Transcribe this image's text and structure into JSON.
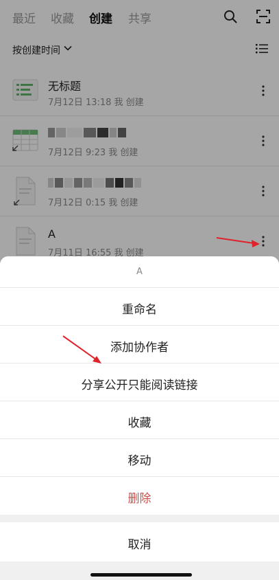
{
  "tabs": [
    {
      "label": "最近",
      "active": false
    },
    {
      "label": "收藏",
      "active": false
    },
    {
      "label": "创建",
      "active": true
    },
    {
      "label": "共享",
      "active": false
    }
  ],
  "sort": {
    "label": "按创建时间"
  },
  "documents": [
    {
      "title": "无标题",
      "meta": "7月12日 13:18 我 创建"
    },
    {
      "title": "",
      "meta": "7月12日 9:23 我 创建"
    },
    {
      "title": "",
      "meta": "7月12日 0:15 我 创建"
    },
    {
      "title": "A",
      "meta": "7月11日 16:55 我 创建"
    }
  ],
  "action_sheet": {
    "title": "A",
    "items": [
      "重命名",
      "添加协作者",
      "分享公开只能阅读链接",
      "收藏",
      "移动",
      "删除"
    ],
    "cancel": "取消"
  },
  "colors": {
    "accent_green": "#5fb36a",
    "danger": "#c9524c",
    "arrow": "#e0222a"
  }
}
